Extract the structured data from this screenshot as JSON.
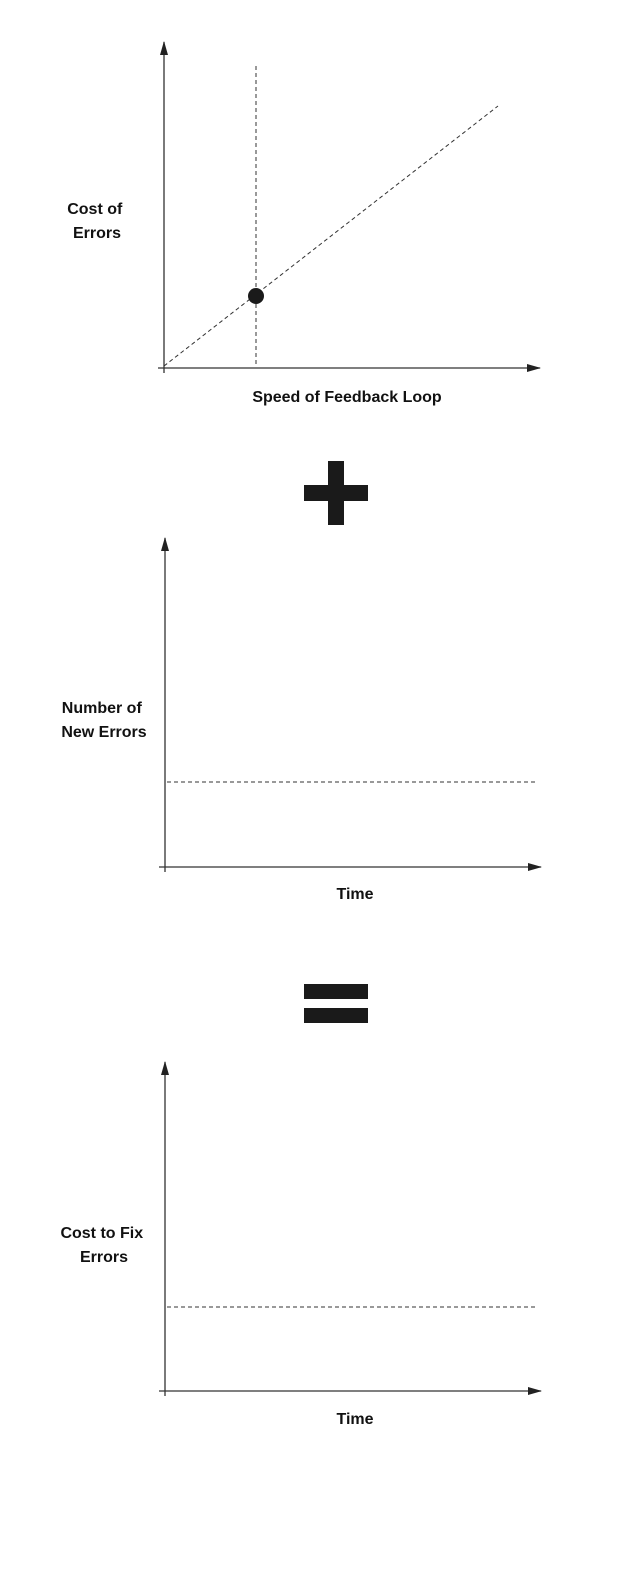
{
  "diagram": {
    "charts": [
      {
        "id": "chart1",
        "ylabel_lines": [
          "Cost of",
          "Errors"
        ],
        "xlabel": "Speed of Feedback Loop",
        "guide": "diagonal",
        "marker": "point"
      },
      {
        "id": "chart2",
        "ylabel_lines": [
          "Number of",
          "New Errors"
        ],
        "xlabel": "Time",
        "guide": "horizontal"
      },
      {
        "id": "chart3",
        "ylabel_lines": [
          "Cost to Fix",
          "Errors"
        ],
        "xlabel": "Time",
        "guide": "horizontal"
      }
    ],
    "operators": [
      "plus",
      "equals"
    ],
    "colors": {
      "ink": "#111111",
      "operator": "#1a1a1a",
      "axis": "#333333"
    }
  }
}
